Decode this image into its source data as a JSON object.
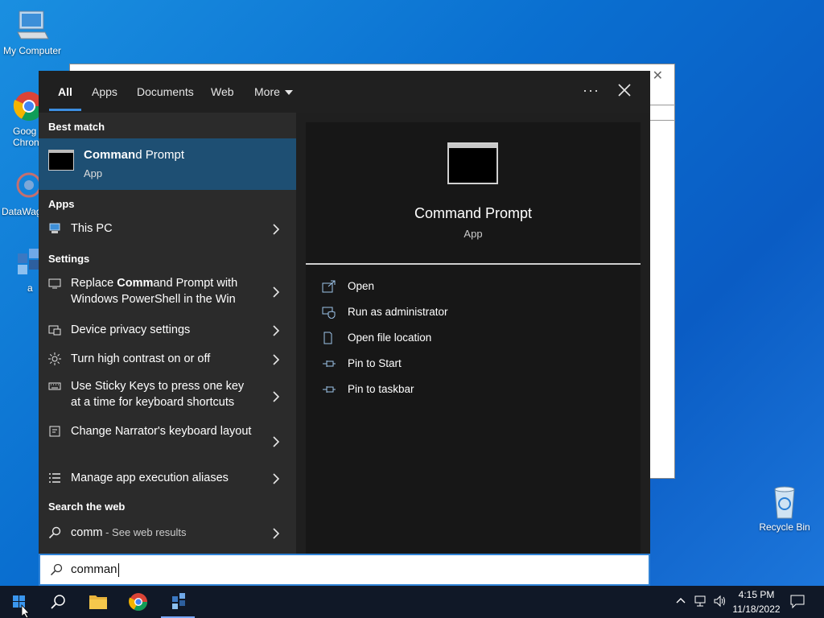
{
  "desktop": {
    "icons": [
      {
        "label": "My Computer"
      },
      {
        "label": "Goog Chron"
      },
      {
        "label": "DataWag"
      },
      {
        "label": "a"
      },
      {
        "label": "Recycle Bin"
      }
    ]
  },
  "search": {
    "tabs": [
      "All",
      "Apps",
      "Documents",
      "Web",
      "More"
    ],
    "active_tab": "All",
    "more_options_icon": "ellipsis-icon",
    "close_icon": "close-icon",
    "best_match_header": "Best match",
    "best_match": {
      "title_bold": "Comman",
      "title_rest": "d Prompt",
      "subtitle": "App"
    },
    "apps_header": "Apps",
    "apps": [
      {
        "label": "This PC"
      }
    ],
    "settings_header": "Settings",
    "settings": [
      {
        "label_pre": "Replace ",
        "label_bold": "Comm",
        "label_post": "and Prompt with Windows PowerShell in the Win"
      },
      {
        "label": "Device privacy settings"
      },
      {
        "label": "Turn high contrast on or off"
      },
      {
        "label": "Use Sticky Keys to press one key at a time for keyboard shortcuts"
      },
      {
        "label": "Change Narrator's keyboard layout"
      },
      {
        "label": "Manage app execution aliases"
      }
    ],
    "web_header": "Search the web",
    "web": {
      "term": "comm",
      "suffix": " - See web results"
    },
    "preview": {
      "title": "Command Prompt",
      "subtitle": "App",
      "actions": [
        {
          "label": "Open",
          "icon": "open-icon"
        },
        {
          "label": "Run as administrator",
          "icon": "shield-icon"
        },
        {
          "label": "Open file location",
          "icon": "file-location-icon"
        },
        {
          "label": "Pin to Start",
          "icon": "pin-icon"
        },
        {
          "label": "Pin to taskbar",
          "icon": "pin-icon"
        }
      ]
    },
    "query": "comman"
  },
  "taskbar": {
    "time": "4:15 PM",
    "date": "11/18/2022"
  },
  "colors": {
    "accent": "#2f82d6",
    "best_match_bg": "#1e4f73",
    "panel_bg": "#1f1f1f"
  }
}
